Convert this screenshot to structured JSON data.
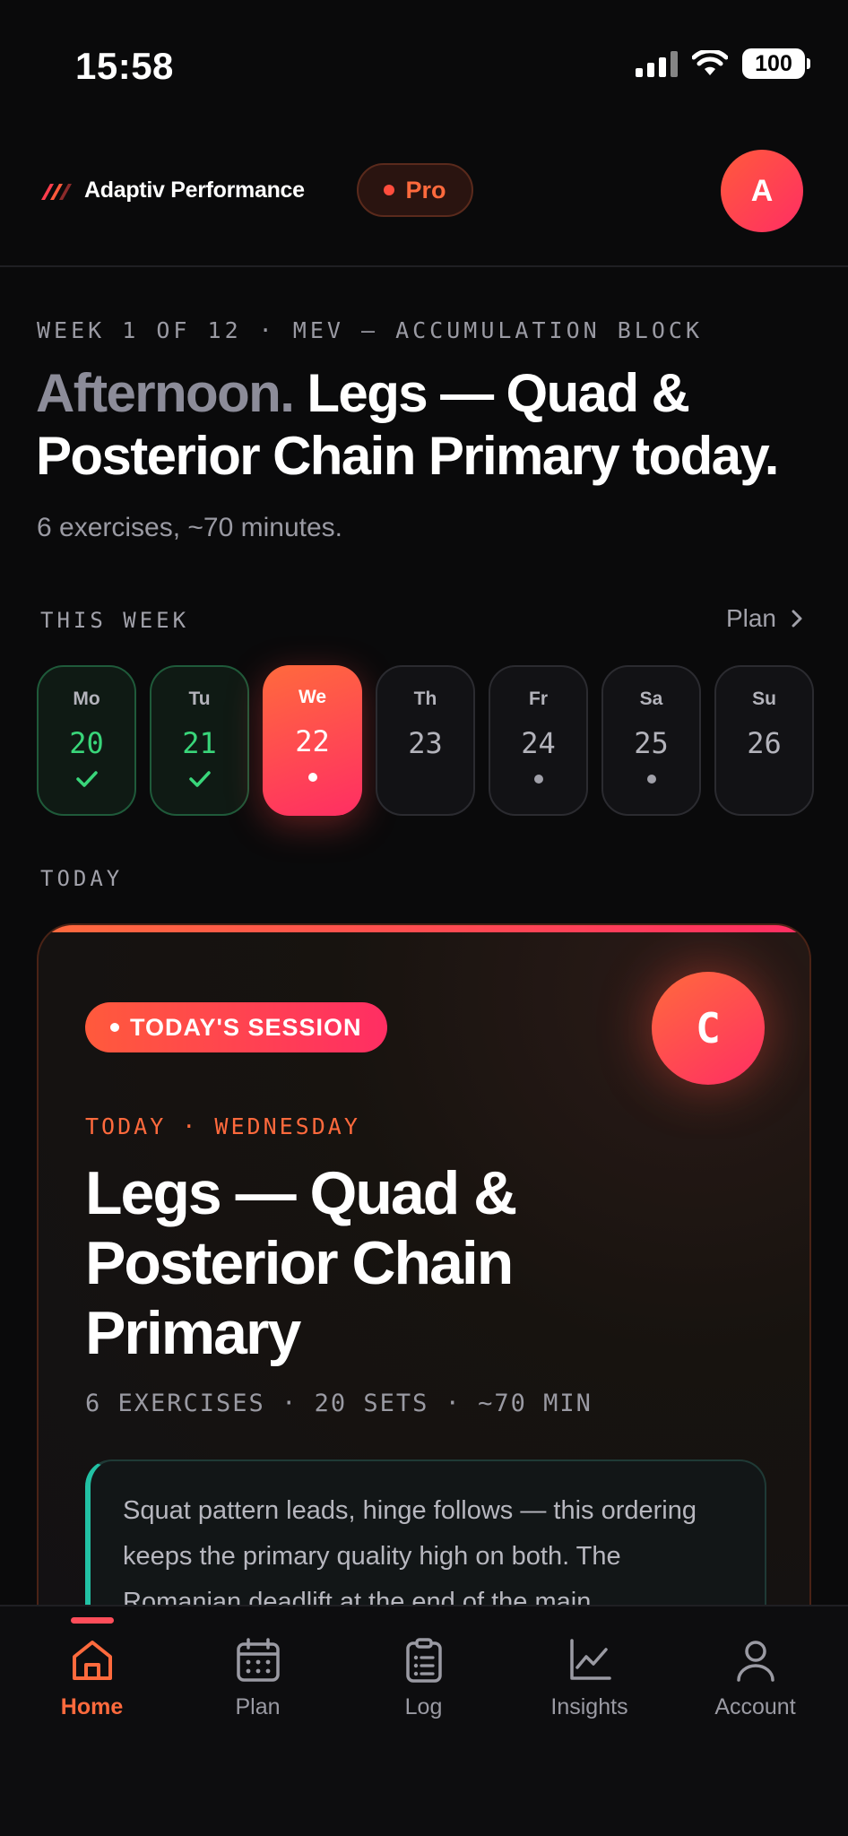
{
  "status": {
    "time": "15:58",
    "battery": "100"
  },
  "header": {
    "brand": "Adaptiv Performance",
    "badge": "Pro",
    "avatar_initial": "A"
  },
  "hero": {
    "block": "WEEK 1 OF 12 · MEV — ACCUMULATION BLOCK",
    "greeting": "Afternoon.",
    "title": "Legs — Quad & Posterior Chain Primary today.",
    "subtitle": "6 exercises, ~70 minutes."
  },
  "week": {
    "label": "THIS WEEK",
    "plan_link": "Plan",
    "days": [
      {
        "name": "Mo",
        "num": "20",
        "state": "done"
      },
      {
        "name": "Tu",
        "num": "21",
        "state": "done"
      },
      {
        "name": "We",
        "num": "22",
        "state": "today"
      },
      {
        "name": "Th",
        "num": "23",
        "state": "rest"
      },
      {
        "name": "Fr",
        "num": "24",
        "state": "planned"
      },
      {
        "name": "Sa",
        "num": "25",
        "state": "planned"
      },
      {
        "name": "Su",
        "num": "26",
        "state": "rest"
      }
    ]
  },
  "today": {
    "label": "TODAY",
    "pill": "TODAY'S SESSION",
    "coach_initial": "C",
    "day_line": "TODAY · WEDNESDAY",
    "title": "Legs — Quad & Posterior Chain Primary",
    "meta": "6 EXERCISES · 20 SETS · ~70 MIN",
    "note": "Squat pattern leads, hinge follows — this ordering keeps the primary quality high on both. The Romanian deadlift at the end of the main"
  },
  "nav": {
    "items": [
      {
        "label": "Home",
        "icon": "home-icon",
        "active": true
      },
      {
        "label": "Plan",
        "icon": "calendar-icon",
        "active": false
      },
      {
        "label": "Log",
        "icon": "clipboard-icon",
        "active": false
      },
      {
        "label": "Insights",
        "icon": "chart-icon",
        "active": false
      },
      {
        "label": "Account",
        "icon": "user-icon",
        "active": false
      }
    ]
  },
  "colors": {
    "accent": "#ff6a3d",
    "accent2": "#ff2e63",
    "done": "#39d67a",
    "note_accent": "#22c1a4",
    "bg": "#0a0a0b"
  }
}
